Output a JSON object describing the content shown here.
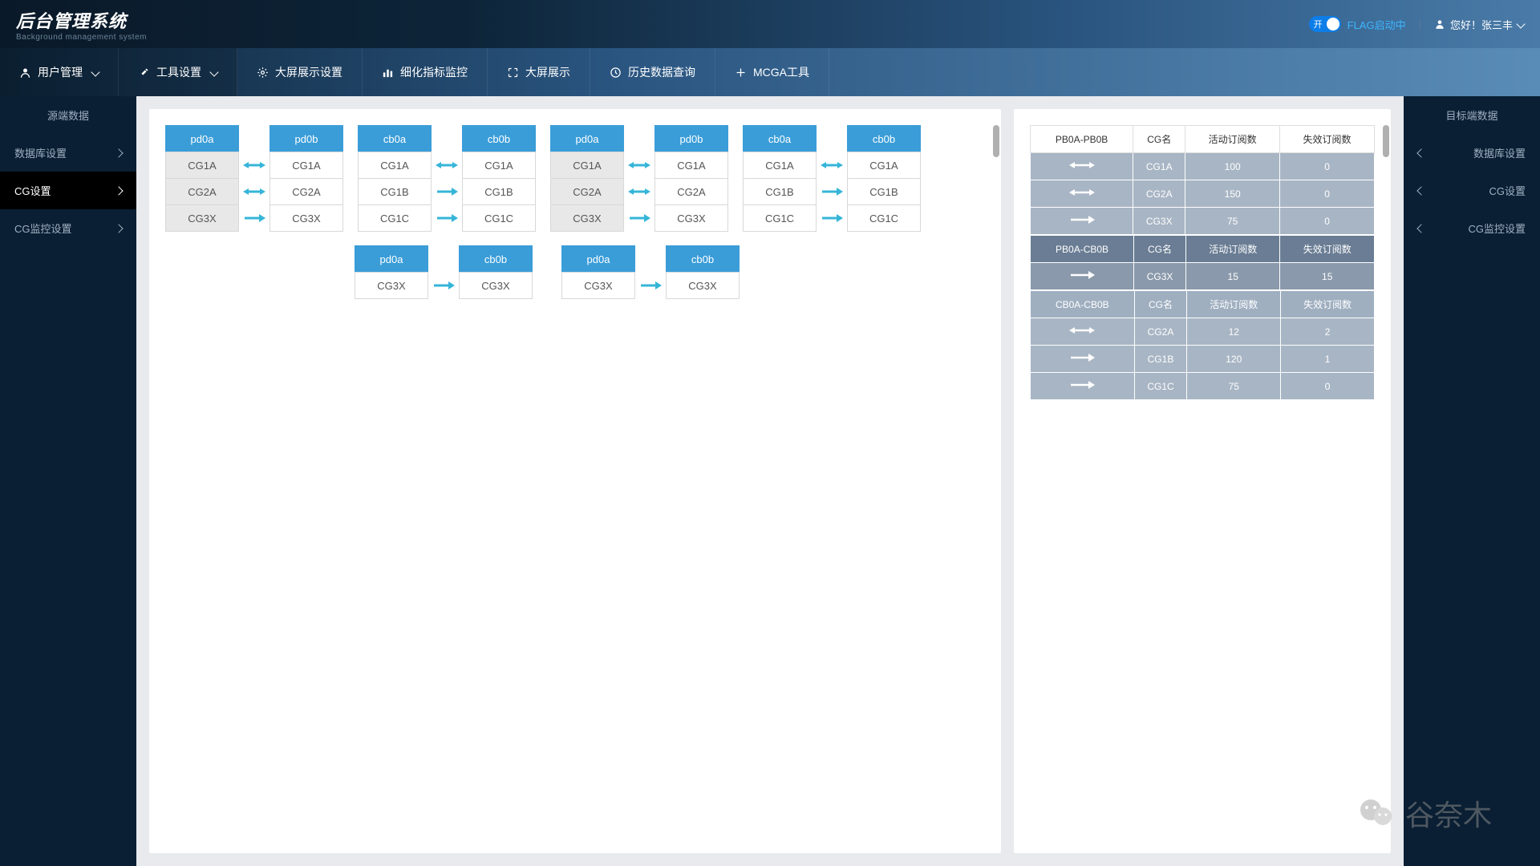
{
  "header": {
    "logo_cn": "后台管理系统",
    "logo_en": "Background management system",
    "toggle_on": "开",
    "flag_label": "FLAG启动中",
    "greeting": "您好！张三丰"
  },
  "nav": [
    {
      "icon": "user",
      "label": "用户管理",
      "caret": true
    },
    {
      "icon": "tool",
      "label": "工具设置",
      "caret": true
    },
    {
      "icon": "gear",
      "label": "大屏展示设置"
    },
    {
      "icon": "chart",
      "label": "细化指标监控"
    },
    {
      "icon": "expand",
      "label": "大屏展示"
    },
    {
      "icon": "clock",
      "label": "历史数据查询"
    },
    {
      "icon": "plus",
      "label": "MCGA工具"
    }
  ],
  "sidebar_left": {
    "title": "源端数据",
    "items": [
      {
        "label": "数据库设置"
      },
      {
        "label": "CG设置",
        "active": true
      },
      {
        "label": "CG监控设置"
      }
    ]
  },
  "sidebar_right": {
    "title": "目标端数据",
    "items": [
      {
        "label": "数据库设置"
      },
      {
        "label": "CG设置"
      },
      {
        "label": "CG监控设置"
      }
    ]
  },
  "diagram": {
    "groups": [
      {
        "colA": {
          "h": "pd0a",
          "cells": [
            "CG1A",
            "CG2A",
            "CG3X"
          ],
          "gray": [
            0,
            1,
            2
          ]
        },
        "arrows": [
          "bi",
          "bi",
          "uni"
        ],
        "colB": {
          "h": "pd0b",
          "cells": [
            "CG1A",
            "CG2A",
            "CG3X"
          ]
        }
      },
      {
        "colA": {
          "h": "cb0a",
          "cells": [
            "CG1A",
            "CG1B",
            "CG1C"
          ]
        },
        "arrows": [
          "bi",
          "uni",
          "uni"
        ],
        "colB": {
          "h": "cb0b",
          "cells": [
            "CG1A",
            "CG1B",
            "CG1C"
          ]
        }
      },
      {
        "colA": {
          "h": "pd0a",
          "cells": [
            "CG1A",
            "CG2A",
            "CG3X"
          ],
          "gray": [
            0,
            1,
            2
          ]
        },
        "arrows": [
          "bi",
          "bi",
          "uni"
        ],
        "colB": {
          "h": "pd0b",
          "cells": [
            "CG1A",
            "CG2A",
            "CG3X"
          ]
        }
      },
      {
        "colA": {
          "h": "cb0a",
          "cells": [
            "CG1A",
            "CG1B",
            "CG1C"
          ]
        },
        "arrows": [
          "bi",
          "uni",
          "uni"
        ],
        "colB": {
          "h": "cb0b",
          "cells": [
            "CG1A",
            "CG1B",
            "CG1C"
          ]
        }
      },
      {
        "colA": {
          "h": "pd0a",
          "cells": [
            "CG3X"
          ]
        },
        "arrows": [
          "uni"
        ],
        "colB": {
          "h": "cb0b",
          "cells": [
            "CG3X"
          ]
        }
      },
      {
        "colA": {
          "h": "pd0a",
          "cells": [
            "CG3X"
          ]
        },
        "arrows": [
          "uni"
        ],
        "colB": {
          "h": "cb0b",
          "cells": [
            "CG3X"
          ]
        }
      }
    ]
  },
  "tables": [
    {
      "hdr_class": "hdr-white",
      "header": [
        "PB0A-PB0B",
        "CG名",
        "活动订阅数",
        "失效订阅数"
      ],
      "rows": [
        {
          "dir": "bi",
          "cg": "CG1A",
          "a": "100",
          "b": "0",
          "dark": false
        },
        {
          "dir": "bi",
          "cg": "CG2A",
          "a": "150",
          "b": "0",
          "dark": false
        },
        {
          "dir": "uni",
          "cg": "CG3X",
          "a": "75",
          "b": "0",
          "dark": false
        }
      ]
    },
    {
      "hdr_class": "hdr-dark",
      "header": [
        "PB0A-CB0B",
        "CG名",
        "活动订阅数",
        "失效订阅数"
      ],
      "rows": [
        {
          "dir": "uni",
          "cg": "CG3X",
          "a": "15",
          "b": "15",
          "dark": true
        }
      ]
    },
    {
      "hdr_class": "hdr-light",
      "header": [
        "CB0A-CB0B",
        "CG名",
        "活动订阅数",
        "失效订阅数"
      ],
      "rows": [
        {
          "dir": "bi",
          "cg": "CG2A",
          "a": "12",
          "b": "2",
          "dark": false
        },
        {
          "dir": "uni",
          "cg": "CG1B",
          "a": "120",
          "b": "1",
          "dark": false
        },
        {
          "dir": "uni",
          "cg": "CG1C",
          "a": "75",
          "b": "0",
          "dark": false
        }
      ]
    }
  ],
  "watermark": "谷奈木"
}
